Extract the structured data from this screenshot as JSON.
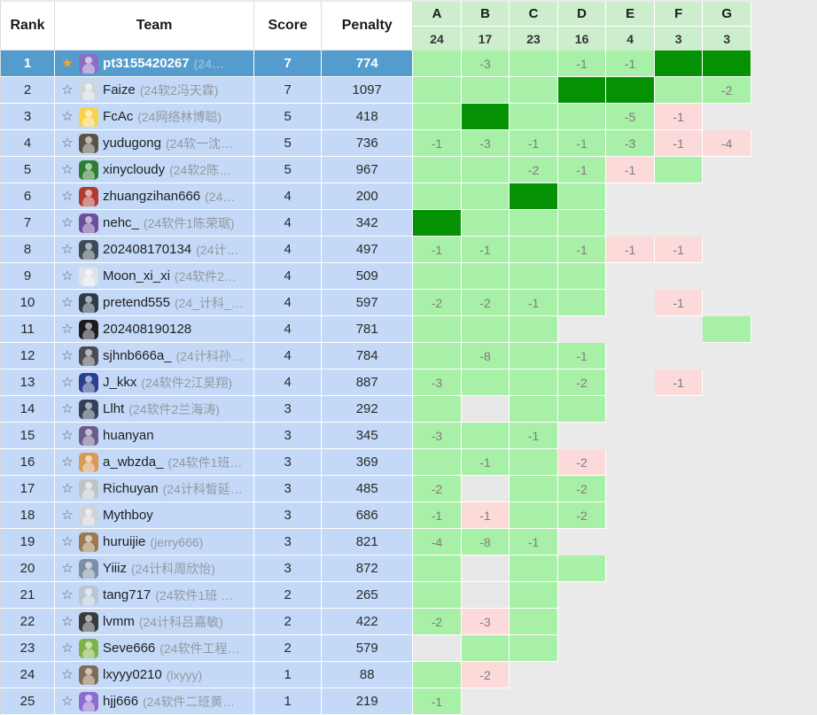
{
  "header": {
    "rank_label": "Rank",
    "team_label": "Team",
    "score_label": "Score",
    "penalty_label": "Penalty",
    "problems": [
      {
        "letter": "A",
        "solved_count": "24"
      },
      {
        "letter": "B",
        "solved_count": "17"
      },
      {
        "letter": "C",
        "solved_count": "23"
      },
      {
        "letter": "D",
        "solved_count": "16"
      },
      {
        "letter": "E",
        "solved_count": "4"
      },
      {
        "letter": "F",
        "solved_count": "3"
      },
      {
        "letter": "G",
        "solved_count": "3"
      }
    ]
  },
  "colors": {
    "highlight_row": "#549cce",
    "row_background": "#c3d9f7",
    "solved": "#a8efa8",
    "first_solve": "#049104",
    "failed": "#fcdada",
    "pending": "#e8e8e8",
    "header_problem": "#cdeecd",
    "page_background": "#eaeaea"
  },
  "icons": {
    "star_filled": "★",
    "star_outline": "☆"
  },
  "rows": [
    {
      "rank": "1",
      "starred": true,
      "highlighted": true,
      "name": "pt3155420267",
      "affiliation": "(24…",
      "score": "7",
      "penalty": "774",
      "cells": [
        {
          "state": "solved",
          "text": ""
        },
        {
          "state": "solved",
          "text": "-3"
        },
        {
          "state": "solved",
          "text": ""
        },
        {
          "state": "solved",
          "text": "-1"
        },
        {
          "state": "solved",
          "text": "-1"
        },
        {
          "state": "first",
          "text": ""
        },
        {
          "state": "first",
          "text": ""
        }
      ]
    },
    {
      "rank": "2",
      "starred": false,
      "highlighted": false,
      "name": "Faize",
      "affiliation": "(24软2冯天霖)",
      "score": "7",
      "penalty": "1097",
      "cells": [
        {
          "state": "solved",
          "text": ""
        },
        {
          "state": "solved",
          "text": ""
        },
        {
          "state": "solved",
          "text": ""
        },
        {
          "state": "first",
          "text": ""
        },
        {
          "state": "first",
          "text": ""
        },
        {
          "state": "solved",
          "text": ""
        },
        {
          "state": "solved",
          "text": "-2"
        }
      ]
    },
    {
      "rank": "3",
      "starred": false,
      "highlighted": false,
      "name": "FcAc",
      "affiliation": "(24网络林博聪)",
      "score": "5",
      "penalty": "418",
      "cells": [
        {
          "state": "solved",
          "text": ""
        },
        {
          "state": "first",
          "text": ""
        },
        {
          "state": "solved",
          "text": ""
        },
        {
          "state": "solved",
          "text": ""
        },
        {
          "state": "solved",
          "text": "-5"
        },
        {
          "state": "failed",
          "text": "-1"
        },
        {
          "state": "empty",
          "text": ""
        }
      ]
    },
    {
      "rank": "4",
      "starred": false,
      "highlighted": false,
      "name": "yudugong",
      "affiliation": "(24软一沈…",
      "score": "5",
      "penalty": "736",
      "cells": [
        {
          "state": "solved",
          "text": "-1"
        },
        {
          "state": "solved",
          "text": "-3"
        },
        {
          "state": "solved",
          "text": "-1"
        },
        {
          "state": "solved",
          "text": "-1"
        },
        {
          "state": "solved",
          "text": "-3"
        },
        {
          "state": "failed",
          "text": "-1"
        },
        {
          "state": "failed",
          "text": "-4"
        }
      ]
    },
    {
      "rank": "5",
      "starred": false,
      "highlighted": false,
      "name": "xinycloudy",
      "affiliation": "(24软2陈…",
      "score": "5",
      "penalty": "967",
      "cells": [
        {
          "state": "solved",
          "text": ""
        },
        {
          "state": "solved",
          "text": ""
        },
        {
          "state": "solved",
          "text": "-2"
        },
        {
          "state": "solved",
          "text": "-1"
        },
        {
          "state": "failed",
          "text": "-1"
        },
        {
          "state": "solved",
          "text": ""
        },
        {
          "state": "empty",
          "text": ""
        }
      ]
    },
    {
      "rank": "6",
      "starred": false,
      "highlighted": false,
      "name": "zhuangzihan666",
      "affiliation": "(24…",
      "score": "4",
      "penalty": "200",
      "cells": [
        {
          "state": "solved",
          "text": ""
        },
        {
          "state": "solved",
          "text": ""
        },
        {
          "state": "first",
          "text": ""
        },
        {
          "state": "solved",
          "text": ""
        },
        {
          "state": "empty",
          "text": ""
        },
        {
          "state": "empty",
          "text": ""
        },
        {
          "state": "empty",
          "text": ""
        }
      ]
    },
    {
      "rank": "7",
      "starred": false,
      "highlighted": false,
      "name": "nehc_",
      "affiliation": "(24软件1陈荣琚)",
      "score": "4",
      "penalty": "342",
      "cells": [
        {
          "state": "first",
          "text": ""
        },
        {
          "state": "solved",
          "text": ""
        },
        {
          "state": "solved",
          "text": ""
        },
        {
          "state": "solved",
          "text": ""
        },
        {
          "state": "empty",
          "text": ""
        },
        {
          "state": "empty",
          "text": ""
        },
        {
          "state": "empty",
          "text": ""
        }
      ]
    },
    {
      "rank": "8",
      "starred": false,
      "highlighted": false,
      "name": "202408170134",
      "affiliation": "(24计…",
      "score": "4",
      "penalty": "497",
      "cells": [
        {
          "state": "solved",
          "text": "-1"
        },
        {
          "state": "solved",
          "text": "-1"
        },
        {
          "state": "solved",
          "text": ""
        },
        {
          "state": "solved",
          "text": "-1"
        },
        {
          "state": "failed",
          "text": "-1"
        },
        {
          "state": "failed",
          "text": "-1"
        },
        {
          "state": "empty",
          "text": ""
        }
      ]
    },
    {
      "rank": "9",
      "starred": false,
      "highlighted": false,
      "name": "Moon_xi_xi",
      "affiliation": "(24软件2…",
      "score": "4",
      "penalty": "509",
      "cells": [
        {
          "state": "solved",
          "text": ""
        },
        {
          "state": "solved",
          "text": ""
        },
        {
          "state": "solved",
          "text": ""
        },
        {
          "state": "solved",
          "text": ""
        },
        {
          "state": "empty",
          "text": ""
        },
        {
          "state": "empty",
          "text": ""
        },
        {
          "state": "empty",
          "text": ""
        }
      ]
    },
    {
      "rank": "10",
      "starred": false,
      "highlighted": false,
      "name": "pretend555",
      "affiliation": "(24_计科_…",
      "score": "4",
      "penalty": "597",
      "cells": [
        {
          "state": "solved",
          "text": "-2"
        },
        {
          "state": "solved",
          "text": "-2"
        },
        {
          "state": "solved",
          "text": "-1"
        },
        {
          "state": "solved",
          "text": ""
        },
        {
          "state": "empty",
          "text": ""
        },
        {
          "state": "failed",
          "text": "-1"
        },
        {
          "state": "empty",
          "text": ""
        }
      ]
    },
    {
      "rank": "11",
      "starred": false,
      "highlighted": false,
      "name": "202408190128",
      "affiliation": "",
      "score": "4",
      "penalty": "781",
      "cells": [
        {
          "state": "solved",
          "text": ""
        },
        {
          "state": "solved",
          "text": ""
        },
        {
          "state": "solved",
          "text": ""
        },
        {
          "state": "empty",
          "text": ""
        },
        {
          "state": "empty",
          "text": ""
        },
        {
          "state": "empty",
          "text": ""
        },
        {
          "state": "solved",
          "text": ""
        }
      ]
    },
    {
      "rank": "12",
      "starred": false,
      "highlighted": false,
      "name": "sjhnb666a_",
      "affiliation": "(24计科孙…",
      "score": "4",
      "penalty": "784",
      "cells": [
        {
          "state": "solved",
          "text": ""
        },
        {
          "state": "solved",
          "text": "-8"
        },
        {
          "state": "solved",
          "text": ""
        },
        {
          "state": "solved",
          "text": "-1"
        },
        {
          "state": "empty",
          "text": ""
        },
        {
          "state": "empty",
          "text": ""
        },
        {
          "state": "empty",
          "text": ""
        }
      ]
    },
    {
      "rank": "13",
      "starred": false,
      "highlighted": false,
      "name": "J_kkx",
      "affiliation": "(24软件2江昊翔)",
      "score": "4",
      "penalty": "887",
      "cells": [
        {
          "state": "solved",
          "text": "-3"
        },
        {
          "state": "solved",
          "text": ""
        },
        {
          "state": "solved",
          "text": ""
        },
        {
          "state": "solved",
          "text": "-2"
        },
        {
          "state": "empty",
          "text": ""
        },
        {
          "state": "failed",
          "text": "-1"
        },
        {
          "state": "empty",
          "text": ""
        }
      ]
    },
    {
      "rank": "14",
      "starred": false,
      "highlighted": false,
      "name": "Llht",
      "affiliation": "(24软件2兰海涛)",
      "score": "3",
      "penalty": "292",
      "cells": [
        {
          "state": "solved",
          "text": ""
        },
        {
          "state": "pending",
          "text": ""
        },
        {
          "state": "solved",
          "text": ""
        },
        {
          "state": "solved",
          "text": ""
        },
        {
          "state": "empty",
          "text": ""
        },
        {
          "state": "empty",
          "text": ""
        },
        {
          "state": "empty",
          "text": ""
        }
      ]
    },
    {
      "rank": "15",
      "starred": false,
      "highlighted": false,
      "name": "huanyan",
      "affiliation": "",
      "score": "3",
      "penalty": "345",
      "cells": [
        {
          "state": "solved",
          "text": "-3"
        },
        {
          "state": "solved",
          "text": ""
        },
        {
          "state": "solved",
          "text": "-1"
        },
        {
          "state": "empty",
          "text": ""
        },
        {
          "state": "empty",
          "text": ""
        },
        {
          "state": "empty",
          "text": ""
        },
        {
          "state": "empty",
          "text": ""
        }
      ]
    },
    {
      "rank": "16",
      "starred": false,
      "highlighted": false,
      "name": "a_wbzda_",
      "affiliation": "(24软件1班…",
      "score": "3",
      "penalty": "369",
      "cells": [
        {
          "state": "solved",
          "text": ""
        },
        {
          "state": "solved",
          "text": "-1"
        },
        {
          "state": "solved",
          "text": ""
        },
        {
          "state": "failed",
          "text": "-2"
        },
        {
          "state": "empty",
          "text": ""
        },
        {
          "state": "empty",
          "text": ""
        },
        {
          "state": "empty",
          "text": ""
        }
      ]
    },
    {
      "rank": "17",
      "starred": false,
      "highlighted": false,
      "name": "Richuyan",
      "affiliation": "(24计科皙延…",
      "score": "3",
      "penalty": "485",
      "cells": [
        {
          "state": "solved",
          "text": "-2"
        },
        {
          "state": "pending",
          "text": ""
        },
        {
          "state": "solved",
          "text": ""
        },
        {
          "state": "solved",
          "text": "-2"
        },
        {
          "state": "empty",
          "text": ""
        },
        {
          "state": "empty",
          "text": ""
        },
        {
          "state": "empty",
          "text": ""
        }
      ]
    },
    {
      "rank": "18",
      "starred": false,
      "highlighted": false,
      "name": "Mythboy",
      "affiliation": "",
      "score": "3",
      "penalty": "686",
      "cells": [
        {
          "state": "solved",
          "text": "-1"
        },
        {
          "state": "failed",
          "text": "-1"
        },
        {
          "state": "solved",
          "text": ""
        },
        {
          "state": "solved",
          "text": "-2"
        },
        {
          "state": "empty",
          "text": ""
        },
        {
          "state": "empty",
          "text": ""
        },
        {
          "state": "empty",
          "text": ""
        }
      ]
    },
    {
      "rank": "19",
      "starred": false,
      "highlighted": false,
      "name": "huruijie",
      "affiliation": "(jerry666)",
      "score": "3",
      "penalty": "821",
      "cells": [
        {
          "state": "solved",
          "text": "-4"
        },
        {
          "state": "solved",
          "text": "-8"
        },
        {
          "state": "solved",
          "text": "-1"
        },
        {
          "state": "empty",
          "text": ""
        },
        {
          "state": "empty",
          "text": ""
        },
        {
          "state": "empty",
          "text": ""
        },
        {
          "state": "empty",
          "text": ""
        }
      ]
    },
    {
      "rank": "20",
      "starred": false,
      "highlighted": false,
      "name": "Yiiiz",
      "affiliation": "(24计科周欣怡)",
      "score": "3",
      "penalty": "872",
      "cells": [
        {
          "state": "solved",
          "text": ""
        },
        {
          "state": "pending",
          "text": ""
        },
        {
          "state": "solved",
          "text": ""
        },
        {
          "state": "solved",
          "text": ""
        },
        {
          "state": "empty",
          "text": ""
        },
        {
          "state": "empty",
          "text": ""
        },
        {
          "state": "empty",
          "text": ""
        }
      ]
    },
    {
      "rank": "21",
      "starred": false,
      "highlighted": false,
      "name": "tang717",
      "affiliation": "(24软件1班 …",
      "score": "2",
      "penalty": "265",
      "cells": [
        {
          "state": "solved",
          "text": ""
        },
        {
          "state": "pending",
          "text": ""
        },
        {
          "state": "solved",
          "text": ""
        },
        {
          "state": "empty",
          "text": ""
        },
        {
          "state": "empty",
          "text": ""
        },
        {
          "state": "empty",
          "text": ""
        },
        {
          "state": "empty",
          "text": ""
        }
      ]
    },
    {
      "rank": "22",
      "starred": false,
      "highlighted": false,
      "name": "lvmm",
      "affiliation": "(24计科吕嘉敏)",
      "score": "2",
      "penalty": "422",
      "cells": [
        {
          "state": "solved",
          "text": "-2"
        },
        {
          "state": "failed",
          "text": "-3"
        },
        {
          "state": "solved",
          "text": ""
        },
        {
          "state": "empty",
          "text": ""
        },
        {
          "state": "empty",
          "text": ""
        },
        {
          "state": "empty",
          "text": ""
        },
        {
          "state": "empty",
          "text": ""
        }
      ]
    },
    {
      "rank": "23",
      "starred": false,
      "highlighted": false,
      "name": "Seve666",
      "affiliation": "(24软件工程…",
      "score": "2",
      "penalty": "579",
      "cells": [
        {
          "state": "pending",
          "text": ""
        },
        {
          "state": "solved",
          "text": ""
        },
        {
          "state": "solved",
          "text": ""
        },
        {
          "state": "empty",
          "text": ""
        },
        {
          "state": "empty",
          "text": ""
        },
        {
          "state": "empty",
          "text": ""
        },
        {
          "state": "empty",
          "text": ""
        }
      ]
    },
    {
      "rank": "24",
      "starred": false,
      "highlighted": false,
      "name": "lxyyy0210",
      "affiliation": "(lxyyy)",
      "score": "1",
      "penalty": "88",
      "cells": [
        {
          "state": "solved",
          "text": ""
        },
        {
          "state": "failed",
          "text": "-2"
        },
        {
          "state": "empty",
          "text": ""
        },
        {
          "state": "empty",
          "text": ""
        },
        {
          "state": "empty",
          "text": ""
        },
        {
          "state": "empty",
          "text": ""
        },
        {
          "state": "empty",
          "text": ""
        }
      ]
    },
    {
      "rank": "25",
      "starred": false,
      "highlighted": false,
      "name": "hjj666",
      "affiliation": "(24软件二班黄…",
      "score": "1",
      "penalty": "219",
      "cells": [
        {
          "state": "solved",
          "text": "-1"
        },
        {
          "state": "empty",
          "text": ""
        },
        {
          "state": "empty",
          "text": ""
        },
        {
          "state": "empty",
          "text": ""
        },
        {
          "state": "empty",
          "text": ""
        },
        {
          "state": "empty",
          "text": ""
        },
        {
          "state": "empty",
          "text": ""
        }
      ]
    }
  ]
}
